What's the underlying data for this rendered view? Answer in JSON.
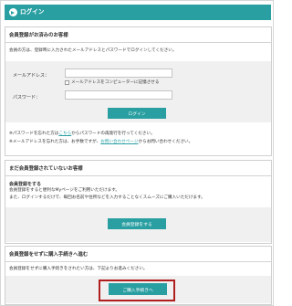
{
  "header": {
    "title": "ログイン"
  },
  "member": {
    "section_title": "会員登録がお済みのお客様",
    "intro": "会員の方は、登録時に入力されたメールアドレスとパスワードでログインしてください。",
    "email_label": "メールアドレス：",
    "email_value": "",
    "remember_label": "メールアドレスをコンピューターに記憶させる",
    "password_label": "パスワード：",
    "password_value": "",
    "login_button": "ログイン",
    "note1_prefix": "※パスワードを忘れた方は",
    "note1_link": "こちら",
    "note1_suffix": "からパスワードの再発行を行ってください。",
    "note2_prefix": "※メールアドレスを忘れた方は、お手数ですが、",
    "note2_link": "お問い合わせページ",
    "note2_suffix": "からお問い合わせください。"
  },
  "guest_register": {
    "section_title": "まだ会員登録されていないお客様",
    "sub_title": "会員登録をする",
    "line1": "会員登録をすると便利なMyページをご利用いただけます。",
    "line2": "また、ログインするだけで、毎回お名前や住所などを入力することなくスムーズにご購入いただけます。",
    "button": "会員登録をする"
  },
  "guest_checkout": {
    "section_title": "会員登録をせずに購入手続きへ進む",
    "line1": "会員登録をせずに購入手続きをされたい方は、下記よりお進みください。",
    "button": "ご購入手続きへ"
  },
  "colors": {
    "accent": "#2a9fa2",
    "highlight": "#b01e1e"
  }
}
